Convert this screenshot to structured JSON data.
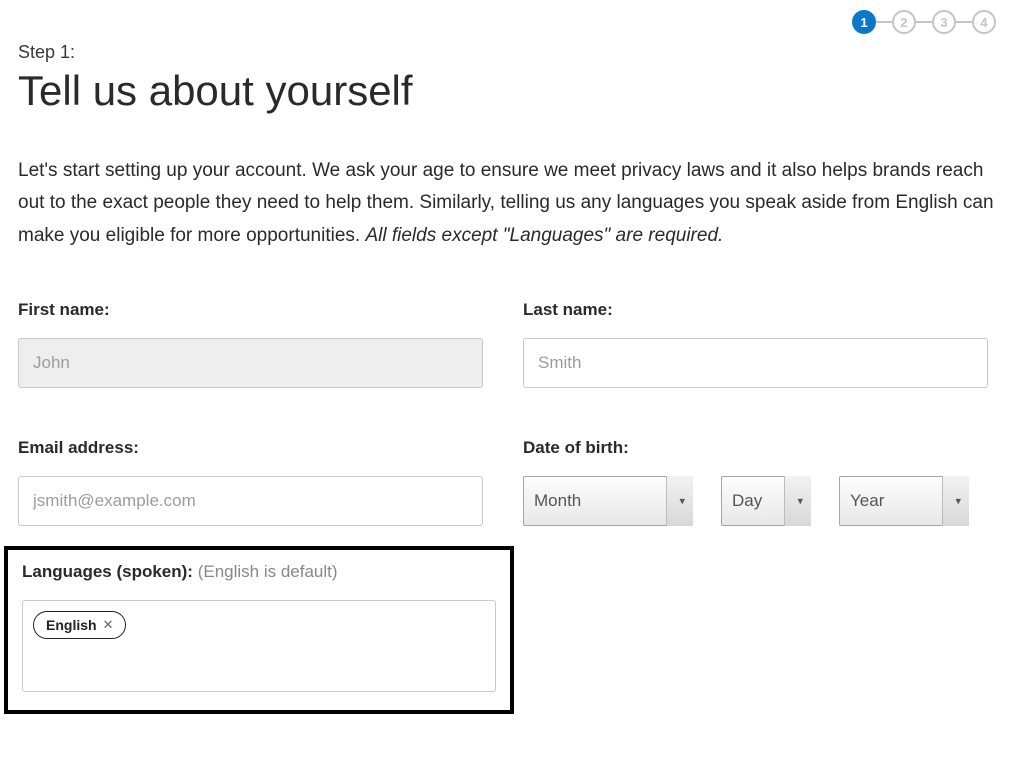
{
  "progress": {
    "steps": [
      "1",
      "2",
      "3",
      "4"
    ],
    "active_index": 0
  },
  "header": {
    "step_label": "Step 1:",
    "title": "Tell us about yourself"
  },
  "intro": {
    "text_main": "Let's start setting up your account. We ask your age to ensure we meet privacy laws and it also helps brands reach out to the exact people they need to help them. Similarly, telling us any languages you speak aside from English can make you eligible for more opportunities. ",
    "text_italic": "All fields except \"Languages\" are required."
  },
  "fields": {
    "first_name": {
      "label": "First name:",
      "placeholder": "John",
      "value": ""
    },
    "last_name": {
      "label": "Last name:",
      "placeholder": "Smith",
      "value": ""
    },
    "email": {
      "label": "Email address:",
      "placeholder": "jsmith@example.com",
      "value": ""
    },
    "dob": {
      "label": "Date of birth:",
      "month_placeholder": "Month",
      "day_placeholder": "Day",
      "year_placeholder": "Year"
    },
    "languages": {
      "label": "Languages (spoken):",
      "sublabel": "(English is default)",
      "tags": [
        "English"
      ]
    }
  }
}
